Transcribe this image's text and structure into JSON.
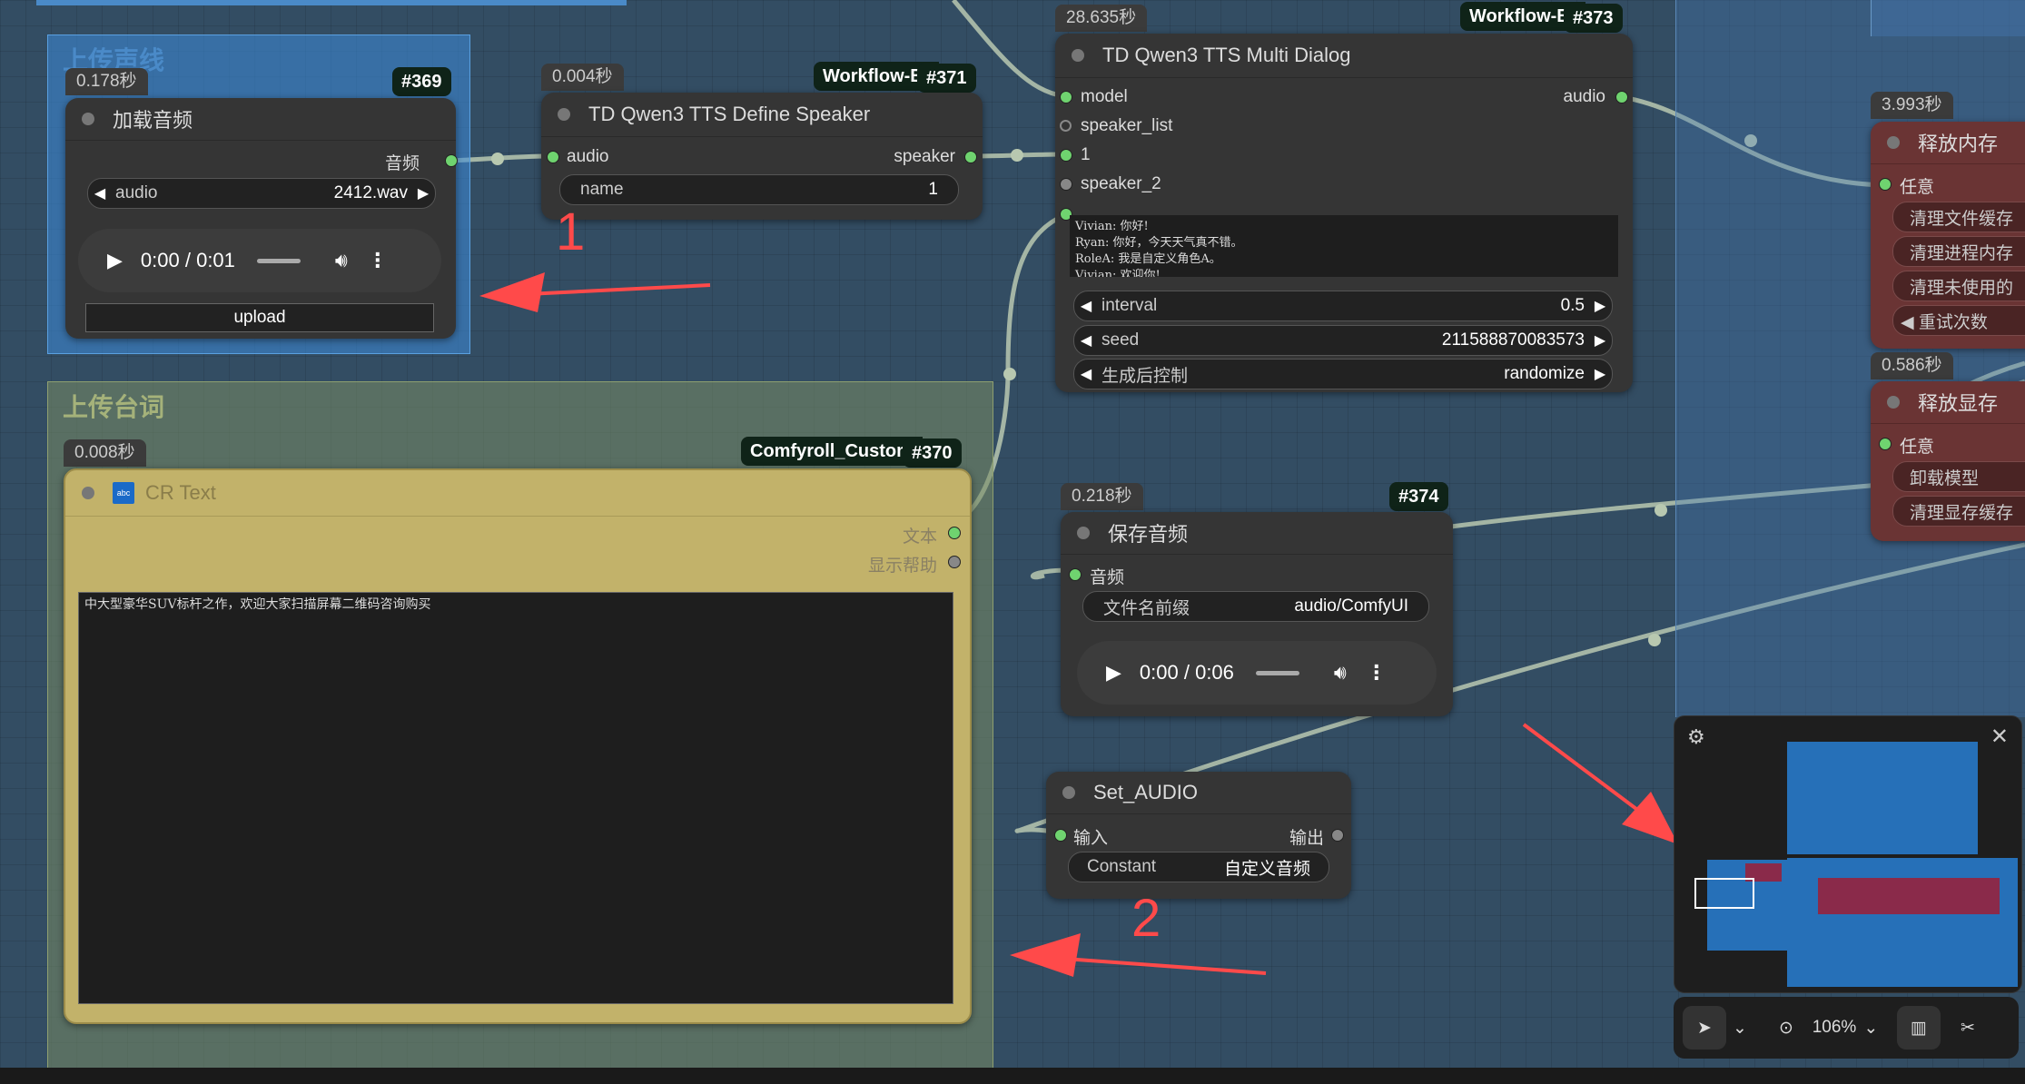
{
  "groups": {
    "upload_voice": {
      "title": "上传声线"
    },
    "upload_lines": {
      "title": "上传台词"
    }
  },
  "nodes": {
    "load_audio": {
      "time": "0.178秒",
      "id": "#369",
      "title": "加载音频",
      "output_label": "音频",
      "audio_widget": {
        "label": "audio",
        "value": "2412.wav"
      },
      "player_time": "0:00 / 0:01",
      "upload_label": "upload"
    },
    "define_speaker": {
      "time": "0.004秒",
      "workflow_badge": "Workflow-E",
      "id": "#371",
      "title": "TD Qwen3 TTS Define Speaker",
      "input_label": "audio",
      "output_label": "speaker",
      "name_widget": {
        "label": "name",
        "value": "1"
      }
    },
    "multi_dialog": {
      "time": "28.635秒",
      "workflow_badge": "Workflow-E",
      "id": "#373",
      "title": "TD Qwen3 TTS Multi Dialog",
      "inputs": [
        "model",
        "speaker_list",
        "1",
        "speaker_2"
      ],
      "output_label": "audio",
      "text": "Vivian: 你好!\nRyan: 你好，今天天气真不错。\nRoleA: 我是自定义角色A。\nVivian: 欢迎你!",
      "widgets": [
        {
          "label": "interval",
          "value": "0.5"
        },
        {
          "label": "seed",
          "value": "211588870083573"
        },
        {
          "label": "生成后控制",
          "value": "randomize"
        }
      ]
    },
    "cr_text": {
      "time": "0.008秒",
      "workflow_badge": "Comfyroll_Custom",
      "id": "#370",
      "icon_text": "abc",
      "title": "CR Text",
      "outputs": [
        "文本",
        "显示帮助"
      ],
      "text": "中大型豪华SUV标杆之作，欢迎大家扫描屏幕二维码咨询购买"
    },
    "save_audio": {
      "time": "0.218秒",
      "id": "#374",
      "title": "保存音频",
      "input_label": "音频",
      "prefix_widget": {
        "label": "文件名前缀",
        "value": "audio/ComfyUI"
      },
      "player_time": "0:00 / 0:06"
    },
    "set_audio": {
      "title": "Set_AUDIO",
      "input_label": "输入",
      "output_label": "输出",
      "const_widget": {
        "label": "Constant",
        "value": "自定义音频"
      }
    },
    "free_memory": {
      "time": "3.993秒",
      "title": "释放内存",
      "input_label": "任意",
      "items": [
        "清理文件缓存",
        "清理进程内存",
        "清理未使用的",
        "◀ 重试次数"
      ]
    },
    "free_vram": {
      "time": "0.586秒",
      "title": "释放显存",
      "input_label": "任意",
      "items": [
        "卸载模型",
        "清理显存缓存"
      ]
    }
  },
  "annotations": {
    "label_1": "1",
    "label_2": "2",
    "color": "#ff4a4a"
  },
  "toolbar": {
    "zoom": "106%"
  },
  "icons": {
    "minimap_settings": "sliders-icon",
    "minimap_close": "close-icon",
    "select": "pointer-icon",
    "fit": "focus-icon",
    "map": "map-icon",
    "links": "link-off-icon"
  }
}
